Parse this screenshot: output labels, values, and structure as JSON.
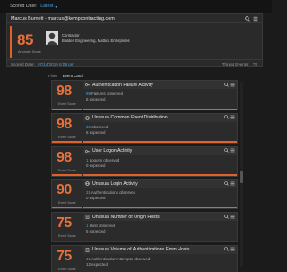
{
  "topbar": {
    "label": "Scored Date:",
    "value": "Latest"
  },
  "user": {
    "header": "Marcus Burnett - marcus@kempcontracting.com",
    "score": "85",
    "score_label": "Anomaly Score",
    "role_line1": "Contractor",
    "role_line2": "Builder, Engineering, Mattica Enterprises",
    "scored_date_label": "Scored Date:",
    "scored_date": "07/14/2019 6:08 pm",
    "threat_events_label": "Threat Events:",
    "threat_events": "75"
  },
  "view": {
    "items": [
      "Filter",
      "Event Card"
    ]
  },
  "events": [
    {
      "score": "98",
      "score_label": "Event Score",
      "icon": "key-icon",
      "title": "Authentication Failure Activity",
      "line1_num": "98",
      "line1_text": "Failures observed",
      "line2": "8 expected"
    },
    {
      "score": "98",
      "score_label": "Event Score",
      "icon": "globe-icon",
      "title": "Unusual Common Event Distribution",
      "line1_num": "30",
      "line1_text": "observed",
      "line2": "6 expected"
    },
    {
      "score": "98",
      "score_label": "Event Score",
      "icon": "key-icon",
      "title": "User Logon Activity",
      "line1_num": "1",
      "line1_text": "Logons observed",
      "line2": "0 expected"
    },
    {
      "score": "90",
      "score_label": "Event Score",
      "icon": "globe-icon",
      "title": "Unusual Login Activity",
      "line1_num": "31",
      "line1_text": "Authentications observed",
      "line2": "0 expected"
    },
    {
      "score": "75",
      "score_label": "Event Score",
      "icon": "document-icon",
      "title": "Unusual Number of Origin Hosts",
      "line1_num": "1",
      "line1_text": "Host observed",
      "line2": "5 expected"
    },
    {
      "score": "75",
      "score_label": "Event Score",
      "icon": "document-icon",
      "title": "Unusual Volume of Authentications From Hosts",
      "line1_num": "41",
      "line1_text": "Authentication Attempts observed",
      "line2": "12 expected"
    }
  ]
}
